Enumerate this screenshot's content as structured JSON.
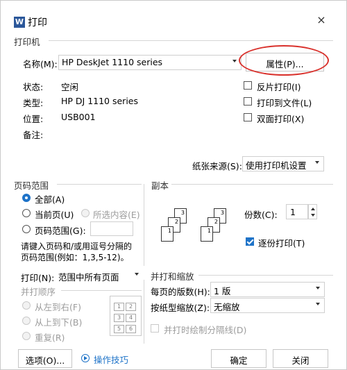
{
  "window": {
    "title": "打印",
    "app_icon": "W",
    "close_icon": "×"
  },
  "printer": {
    "section_title": "打印机",
    "name_label": "名称(M):",
    "name_value": "HP DeskJet 1110 series",
    "properties_button": "属性(P)...",
    "status_label": "状态:",
    "status_value": "空闲",
    "type_label": "类型:",
    "type_value": "HP DJ 1110 series",
    "location_label": "位置:",
    "location_value": "USB001",
    "comment_label": "备注:",
    "reverse_print": "反片打印(I)",
    "print_to_file": "打印到文件(L)",
    "duplex": "双面打印(X)",
    "paper_source_label": "纸张来源(S):",
    "paper_source_value": "使用打印机设置"
  },
  "page_range": {
    "title": "页码范围",
    "all": "全部(A)",
    "current": "当前页(U)",
    "selection": "所选内容(E)",
    "pages": "页码范围(G):",
    "pages_value": "",
    "hint_line1": "请键入页码和/或用逗号分隔的",
    "hint_line2": "页码范围(例如：1,3,5-12)。"
  },
  "copies": {
    "title": "副本",
    "count_label": "份数(C):",
    "count_value": "1",
    "collate": "逐份打印(T)",
    "stack1": [
      "1",
      "2",
      "3"
    ],
    "stack2": [
      "1",
      "2",
      "3"
    ]
  },
  "print_what": {
    "label": "打印(N):",
    "value": "范围中所有页面"
  },
  "print_order": {
    "title": "并打顺序",
    "left_to_right": "从左到右(F)",
    "top_to_bottom": "从上到下(B)",
    "repeat": "重复(R)",
    "grid": [
      "1",
      "2",
      "3",
      "4",
      "5",
      "6"
    ]
  },
  "zoom": {
    "title": "并打和缩放",
    "pages_per_sheet_label": "每页的版数(H):",
    "pages_per_sheet_value": "1 版",
    "scale_label": "按纸型缩放(Z):",
    "scale_value": "无缩放",
    "draw_borders": "并打时绘制分隔线(D)"
  },
  "footer": {
    "options": "选项(O)...",
    "tips": "操作技巧",
    "ok": "确定",
    "close": "关闭"
  },
  "colors": {
    "accent": "#1e73c8",
    "highlight_ellipse": "#d9312c"
  }
}
